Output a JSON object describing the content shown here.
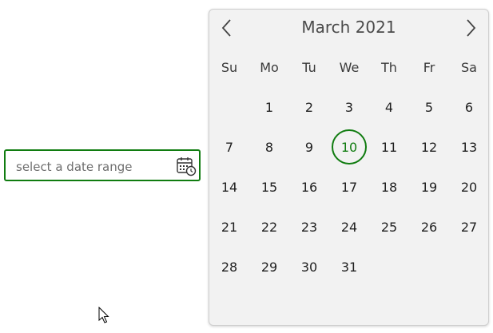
{
  "date_input": {
    "placeholder": "select a date range",
    "icon": "calendar-clock-icon",
    "border_color": "#107c10"
  },
  "calendar": {
    "month_title": "March 2021",
    "prev_icon": "chevron-left-icon",
    "next_icon": "chevron-right-icon",
    "weekdays": [
      "Su",
      "Mo",
      "Tu",
      "We",
      "Th",
      "Fr",
      "Sa"
    ],
    "weeks": [
      [
        "",
        "1",
        "2",
        "3",
        "4",
        "5",
        "6"
      ],
      [
        "7",
        "8",
        "9",
        "10",
        "11",
        "12",
        "13"
      ],
      [
        "14",
        "15",
        "16",
        "17",
        "18",
        "19",
        "20"
      ],
      [
        "21",
        "22",
        "23",
        "24",
        "25",
        "26",
        "27"
      ],
      [
        "28",
        "29",
        "30",
        "31",
        "",
        "",
        ""
      ]
    ],
    "today": "10",
    "accent_color": "#107c10",
    "background_color": "#f2f2f2"
  }
}
